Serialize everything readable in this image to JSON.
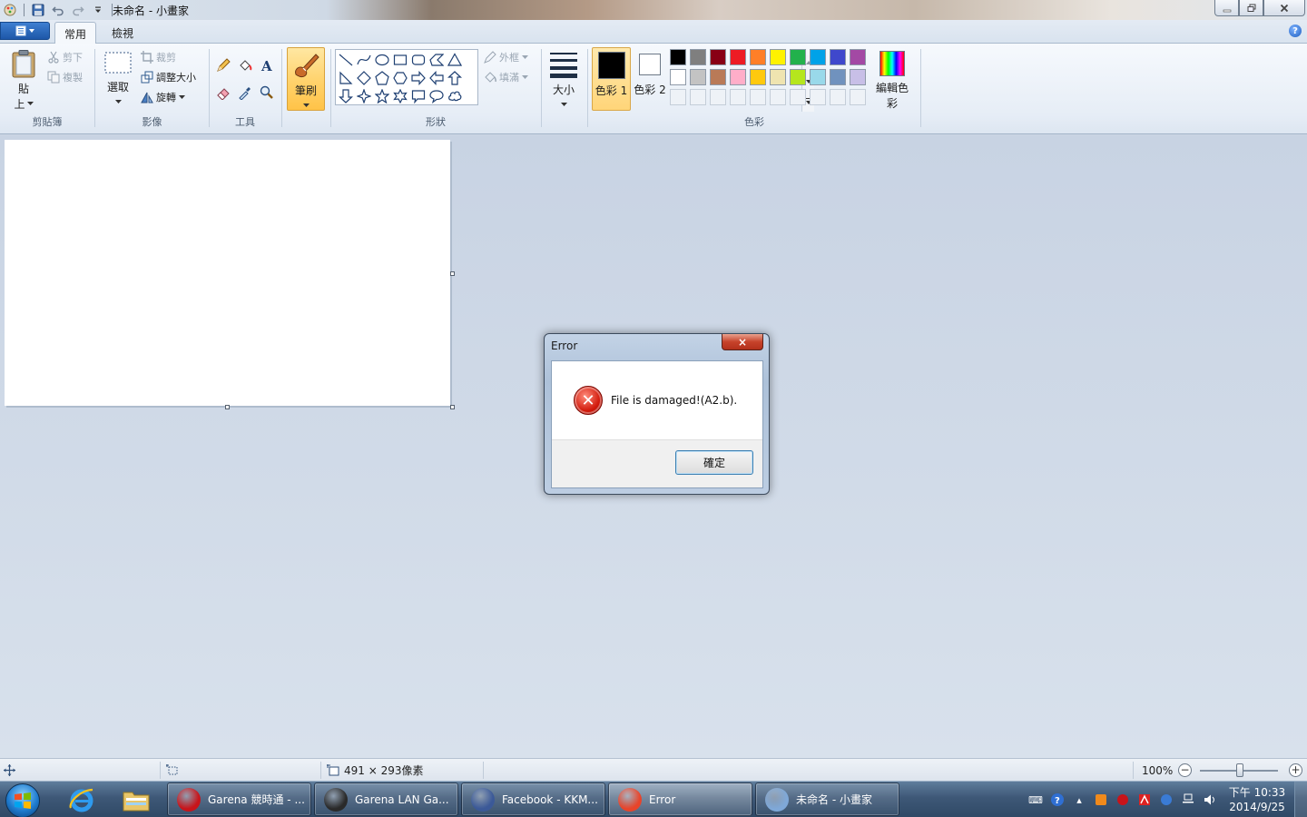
{
  "window": {
    "title": "未命名 - 小畫家"
  },
  "tabs": [
    {
      "label": "常用",
      "active": true
    },
    {
      "label": "檢視",
      "active": false
    }
  ],
  "ribbon": {
    "clipboard": {
      "label": "剪貼簿",
      "paste_line1": "貼",
      "paste_line2": "上",
      "cut": "剪下",
      "copy": "複製"
    },
    "image": {
      "label": "影像",
      "select": "選取",
      "crop": "裁剪",
      "resize": "調整大小",
      "rotate": "旋轉"
    },
    "tools": {
      "label": "工具"
    },
    "brushes": {
      "label": "筆刷"
    },
    "shapes": {
      "label": "形狀",
      "outline": "外框",
      "fill": "填滿"
    },
    "size": {
      "label": "大小"
    },
    "colors": {
      "label": "色彩",
      "color1": "色彩 1",
      "color2": "色彩 2",
      "edit": "編輯色彩",
      "palette_row1": [
        "#000000",
        "#7f7f7f",
        "#880015",
        "#ed1c24",
        "#ff7f27",
        "#fff200",
        "#22b14c",
        "#00a2e8",
        "#3f48cc",
        "#a349a4"
      ],
      "palette_row2": [
        "#ffffff",
        "#c3c3c3",
        "#b97a57",
        "#ffaec9",
        "#ffc90e",
        "#efe4b0",
        "#b5e61d",
        "#99d9ea",
        "#7092be",
        "#c8bfe7"
      ]
    }
  },
  "dialog": {
    "title": "Error",
    "close_glyph": "×",
    "message": "File is damaged!(A2.b).",
    "ok_label": "確定"
  },
  "statusbar": {
    "dimensions": "491 × 293像素",
    "zoom": "100%"
  },
  "taskbar": {
    "tasks": [
      {
        "label": "Garena 競時通 - ...",
        "icon_color": "#c8141a"
      },
      {
        "label": "Garena LAN Ga...",
        "icon_color": "#2a2a2a"
      },
      {
        "label": "Facebook - KKM...",
        "icon_color": "#3b5998"
      },
      {
        "label": "Error",
        "icon_color": "#e8442a"
      },
      {
        "label": "未命名 - 小畫家",
        "icon_color": "#7fa8d8"
      }
    ],
    "clock_time": "下午 10:33",
    "clock_date": "2014/9/25"
  }
}
